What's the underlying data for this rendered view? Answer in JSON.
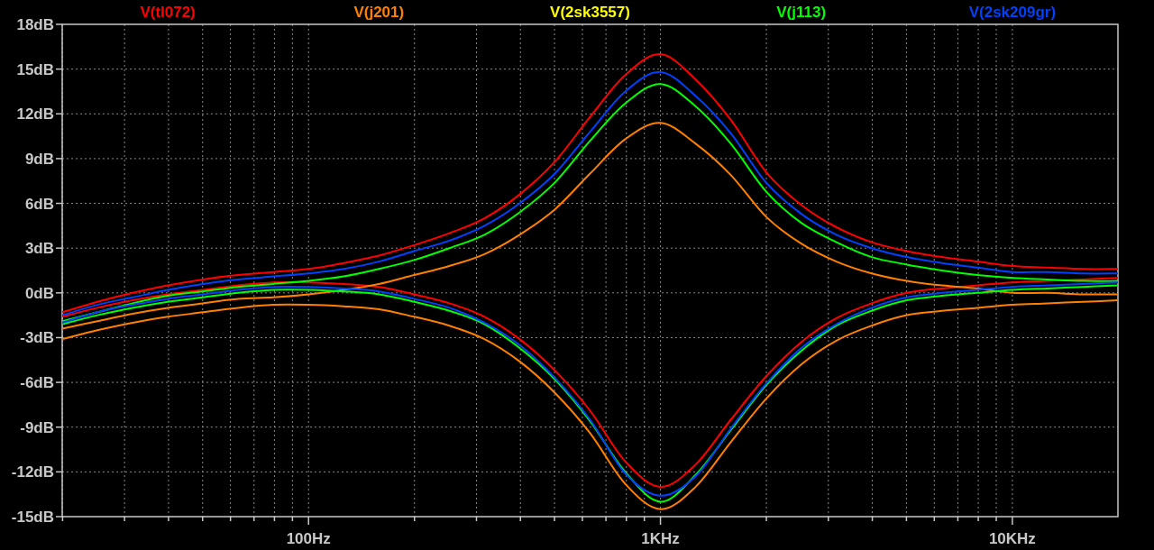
{
  "chart_data": {
    "type": "line",
    "grid": true,
    "categories": [
      null,
      null,
      null,
      null,
      null,
      null,
      null,
      "100Hz",
      null,
      null,
      null,
      null,
      null,
      null,
      null,
      null,
      null,
      "1KHz",
      null,
      null,
      null,
      null,
      null,
      null,
      null,
      null,
      null,
      "10KHz",
      null,
      null,
      null
    ],
    "ylim": [
      -15,
      18
    ],
    "yticks": [
      {
        "value": 18,
        "label": "18dB"
      },
      {
        "value": 15,
        "label": "15dB"
      },
      {
        "value": 12,
        "label": "12dB"
      },
      {
        "value": 9,
        "label": "9dB"
      },
      {
        "value": 6,
        "label": "6dB"
      },
      {
        "value": 3,
        "label": "3dB"
      },
      {
        "value": 0,
        "label": "0dB"
      },
      {
        "value": -3,
        "label": "-3dB"
      },
      {
        "value": -6,
        "label": "-6dB"
      },
      {
        "value": -9,
        "label": "-9dB"
      },
      {
        "value": -12,
        "label": "-12dB"
      },
      {
        "value": -15,
        "label": "-15dB"
      }
    ],
    "series": [
      {
        "name": "V(tl072)",
        "color": "#ff0000",
        "values": [
          -1.3,
          -0.6,
          0.0,
          0.5,
          0.9,
          1.2,
          1.4,
          1.6,
          2.0,
          2.5,
          3.2,
          4.0,
          5.0,
          6.6,
          8.8,
          11.8,
          14.6,
          16.0,
          14.3,
          11.6,
          8.1,
          5.9,
          4.4,
          3.4,
          2.8,
          2.4,
          2.1,
          1.8,
          1.7,
          1.6,
          1.6
        ]
      },
      {
        "color": "#ff0000",
        "values": [
          -1.6,
          -1.0,
          -0.5,
          -0.1,
          0.2,
          0.5,
          0.7,
          0.7,
          0.6,
          0.4,
          -0.1,
          -0.7,
          -1.6,
          -3.1,
          -5.2,
          -7.9,
          -11.3,
          -13.0,
          -11.5,
          -8.5,
          -5.6,
          -3.3,
          -1.7,
          -0.7,
          0.0,
          0.3,
          0.5,
          0.7,
          0.8,
          0.9,
          1.0
        ]
      },
      {
        "name": "V(j201)",
        "color": "#ff8000",
        "values": [
          -2.4,
          -1.9,
          -1.4,
          -1.0,
          -0.7,
          -0.4,
          -0.3,
          -0.1,
          0.2,
          0.6,
          1.2,
          1.8,
          2.6,
          3.9,
          5.6,
          8.0,
          10.3,
          11.4,
          10.0,
          7.9,
          5.1,
          3.3,
          2.1,
          1.3,
          0.8,
          0.5,
          0.3,
          0.0,
          0.0,
          -0.1,
          -0.1
        ]
      },
      {
        "color": "#ff8000",
        "values": [
          -3.1,
          -2.5,
          -2.0,
          -1.6,
          -1.3,
          -1.0,
          -0.8,
          -0.8,
          -0.9,
          -1.1,
          -1.6,
          -2.2,
          -3.1,
          -4.6,
          -6.7,
          -9.4,
          -12.8,
          -14.5,
          -13.0,
          -10.0,
          -7.1,
          -4.8,
          -3.2,
          -2.2,
          -1.5,
          -1.2,
          -1.0,
          -0.8,
          -0.7,
          -0.6,
          -0.5
        ]
      },
      {
        "name": "V(2sk3557)",
        "color": "#ffff00",
        "values": [
          null,
          null,
          null,
          null,
          null,
          null,
          null,
          null,
          null,
          null,
          null,
          null,
          null,
          null,
          null,
          null,
          null,
          null,
          null,
          null,
          null,
          null,
          null,
          null,
          null,
          null,
          null,
          null,
          null,
          null,
          null
        ]
      },
      {
        "name": "V(j113)",
        "color": "#00ff00",
        "values": [
          -1.9,
          -1.3,
          -0.7,
          -0.2,
          0.1,
          0.4,
          0.6,
          0.8,
          1.1,
          1.6,
          2.2,
          3.0,
          3.9,
          5.4,
          7.4,
          10.2,
          12.7,
          14.0,
          12.5,
          10.0,
          6.8,
          4.7,
          3.4,
          2.4,
          1.9,
          1.5,
          1.2,
          1.0,
          0.9,
          0.8,
          0.8
        ]
      },
      {
        "color": "#00ff00",
        "values": [
          -2.1,
          -1.5,
          -1.0,
          -0.6,
          -0.3,
          0.0,
          0.2,
          0.2,
          0.1,
          -0.1,
          -0.6,
          -1.2,
          -2.1,
          -3.7,
          -5.8,
          -8.6,
          -12.0,
          -14.0,
          -12.2,
          -9.2,
          -6.2,
          -3.9,
          -2.2,
          -1.2,
          -0.5,
          -0.2,
          0.0,
          0.2,
          0.3,
          0.4,
          0.5
        ]
      },
      {
        "name": "V(2sk209gr)",
        "color": "#0040ff",
        "values": [
          -1.5,
          -0.8,
          -0.3,
          0.2,
          0.6,
          0.9,
          1.1,
          1.3,
          1.6,
          2.1,
          2.8,
          3.5,
          4.5,
          6.0,
          8.0,
          10.8,
          13.5,
          14.8,
          13.2,
          10.7,
          7.4,
          5.3,
          3.9,
          3.0,
          2.4,
          2.0,
          1.7,
          1.4,
          1.4,
          1.3,
          1.3
        ]
      },
      {
        "color": "#0040ff",
        "values": [
          -2.0,
          -1.3,
          -0.8,
          -0.4,
          -0.1,
          0.2,
          0.4,
          0.4,
          0.3,
          0.1,
          -0.4,
          -1.0,
          -2.0,
          -3.5,
          -5.7,
          -8.5,
          -12.1,
          -13.6,
          -12.3,
          -9.1,
          -6.1,
          -3.7,
          -2.1,
          -1.0,
          -0.3,
          0.0,
          0.2,
          0.4,
          0.5,
          0.6,
          0.7
        ]
      }
    ]
  }
}
